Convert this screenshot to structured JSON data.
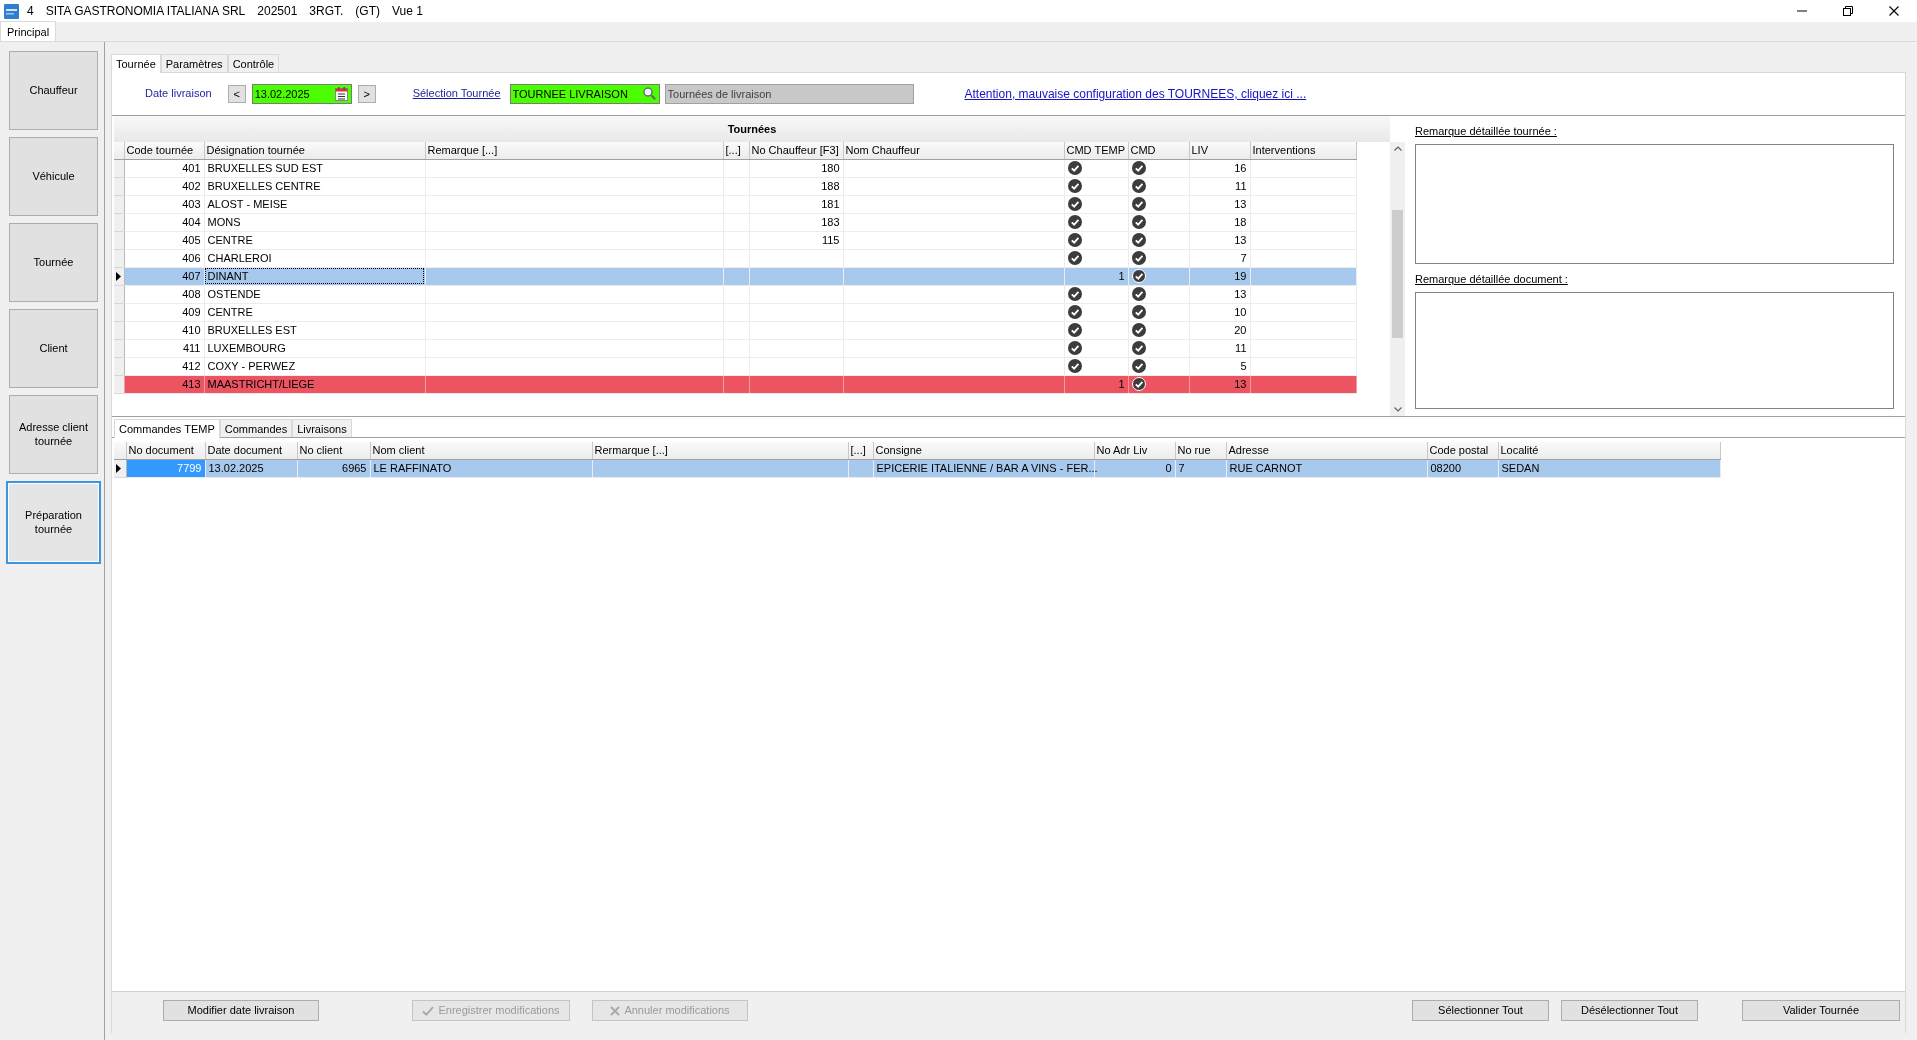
{
  "window": {
    "title_parts": [
      "4",
      "SITA GASTRONOMIA ITALIANA SRL",
      "202501",
      "3RGT.",
      "(GT)",
      "Vue 1"
    ]
  },
  "ribbon_tabs": [
    {
      "label": "Principal",
      "selected": true
    }
  ],
  "sidebar": {
    "items": [
      {
        "label": "Chauffeur",
        "selected": false
      },
      {
        "label": "Véhicule",
        "selected": false
      },
      {
        "label": "Tournée",
        "selected": false
      },
      {
        "label": "Client",
        "selected": false
      },
      {
        "label": "Adresse client tournée",
        "selected": false
      },
      {
        "label": "Préparation tournée",
        "selected": true
      }
    ]
  },
  "tabs": [
    {
      "label": "Tournée",
      "selected": true
    },
    {
      "label": "Paramètres",
      "selected": false
    },
    {
      "label": "Contrôle",
      "selected": false
    }
  ],
  "toolbar": {
    "date_label": "Date livraison",
    "previous": "<",
    "date": "13.02.2025",
    "next": ">",
    "selection_link": "Sélection Tournée",
    "selection_value": "TOURNEE LIVRAISON",
    "selection_description": "Tournées de livraison",
    "warning_link": "Attention, mauvaise configuration des TOURNEES, cliquez ici ..."
  },
  "tours_table": {
    "title": "Tournées",
    "columns": [
      "Code tournée",
      "Désignation tournée",
      "Remarque [...]",
      "[...]",
      "No Chauffeur [F3]",
      "Nom Chauffeur",
      "CMD TEMP",
      "CMD",
      "LIV",
      "Interventions"
    ],
    "rows": [
      {
        "code": "401",
        "designation": "BRUXELLES SUD EST",
        "driver_no": "180",
        "cmd_temp": {
          "kind": "tick"
        },
        "cmd_checked": true,
        "liv": "16",
        "selected": false,
        "alert": false
      },
      {
        "code": "402",
        "designation": "BRUXELLES CENTRE",
        "driver_no": "188",
        "cmd_temp": {
          "kind": "tick"
        },
        "cmd_checked": true,
        "liv": "11",
        "selected": false,
        "alert": false
      },
      {
        "code": "403",
        "designation": "ALOST - MEISE",
        "driver_no": "181",
        "cmd_temp": {
          "kind": "tick"
        },
        "cmd_checked": true,
        "liv": "13",
        "selected": false,
        "alert": false
      },
      {
        "code": "404",
        "designation": "MONS",
        "driver_no": "183",
        "cmd_temp": {
          "kind": "tick"
        },
        "cmd_checked": true,
        "liv": "18",
        "selected": false,
        "alert": false
      },
      {
        "code": "405",
        "designation": "CENTRE",
        "driver_no": "115",
        "cmd_temp": {
          "kind": "tick"
        },
        "cmd_checked": true,
        "liv": "13",
        "selected": false,
        "alert": false
      },
      {
        "code": "406",
        "designation": "CHARLEROI",
        "cmd_temp": {
          "kind": "tick"
        },
        "cmd_checked": true,
        "liv": "7",
        "selected": false,
        "alert": false
      },
      {
        "code": "407",
        "designation": "DINANT",
        "cmd_temp": {
          "kind": "count",
          "text": "1"
        },
        "cmd_checked": true,
        "liv": "19",
        "selected": true,
        "alert": false
      },
      {
        "code": "408",
        "designation": "OSTENDE",
        "cmd_temp": {
          "kind": "tick"
        },
        "cmd_checked": true,
        "liv": "13",
        "selected": false,
        "alert": false
      },
      {
        "code": "409",
        "designation": "CENTRE",
        "cmd_temp": {
          "kind": "tick"
        },
        "cmd_checked": true,
        "liv": "10",
        "selected": false,
        "alert": false
      },
      {
        "code": "410",
        "designation": "BRUXELLES EST",
        "cmd_temp": {
          "kind": "tick"
        },
        "cmd_checked": true,
        "liv": "20",
        "selected": false,
        "alert": false
      },
      {
        "code": "411",
        "designation": "LUXEMBOURG",
        "cmd_temp": {
          "kind": "tick"
        },
        "cmd_checked": true,
        "liv": "11",
        "selected": false,
        "alert": false
      },
      {
        "code": "412",
        "designation": "COXY - PERWEZ",
        "cmd_temp": {
          "kind": "tick"
        },
        "cmd_checked": true,
        "liv": "5",
        "selected": false,
        "alert": false
      },
      {
        "code": "413",
        "designation": "MAASTRICHT/LIEGE",
        "cmd_temp": {
          "kind": "count",
          "text": "1"
        },
        "cmd_checked": true,
        "liv": "13",
        "selected": false,
        "alert": true
      }
    ]
  },
  "remarks": [
    {
      "label": "Remarque détaillée tournée :"
    },
    {
      "label": "Remarque détaillée document :"
    }
  ],
  "bottom_tabs": [
    {
      "label": "Commandes TEMP",
      "selected": true
    },
    {
      "label": "Commandes",
      "selected": false
    },
    {
      "label": "Livraisons",
      "selected": false
    }
  ],
  "orders_table": {
    "columns": [
      "No document",
      "Date document",
      "No client",
      "Nom client",
      "Rermarque [...]",
      "[...]",
      "Consigne",
      "No Adr Liv",
      "No rue",
      "Adresse",
      "Code postal",
      "Localité"
    ],
    "rows": [
      {
        "no_document": "7799",
        "date_document": "13.02.2025",
        "no_client": "6965",
        "client_name": "LE RAFFINATO",
        "consigne": "EPICERIE ITALIENNE / BAR A VINS - FER...",
        "no_adr_liv": "0",
        "no_rue": "7",
        "adresse": "RUE CARNOT",
        "code_postal": "08200",
        "localite": "SEDAN",
        "selected": true
      }
    ]
  },
  "buttons": [
    {
      "label": "Modifier date livraison",
      "kind": "plain",
      "disabled": false
    },
    {
      "label": "Enregistrer modifications",
      "kind": "save",
      "disabled": true
    },
    {
      "label": "Annuler modifications",
      "kind": "cancel",
      "disabled": true
    },
    {
      "label": "Sélectionner Tout",
      "kind": "plain",
      "disabled": false
    },
    {
      "label": "Désélectionner Tout",
      "kind": "plain",
      "disabled": false
    },
    {
      "label": "Valider Tournée",
      "kind": "plain",
      "disabled": false
    }
  ]
}
